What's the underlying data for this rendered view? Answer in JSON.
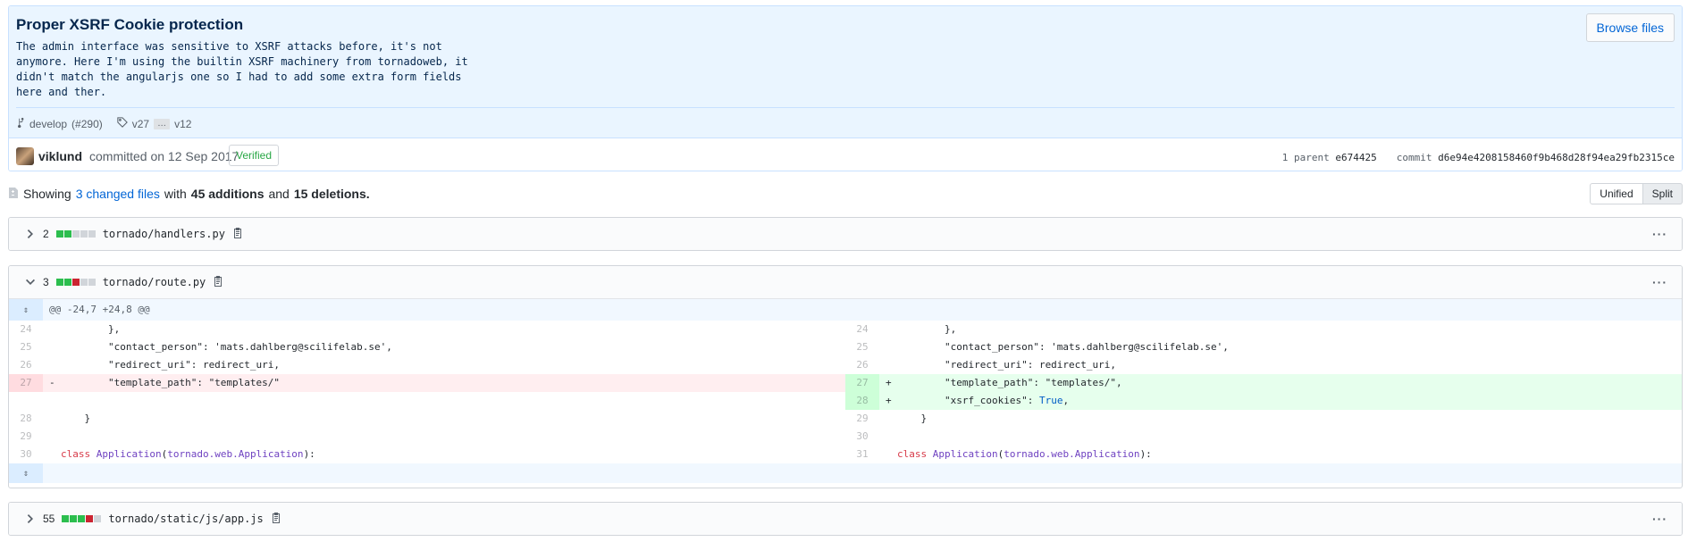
{
  "commit": {
    "title": "Proper XSRF Cookie protection",
    "description": "The admin interface was sensitive to XSRF attacks before, it's not\nanymore. Here I'm using the builtin XSRF machinery from tornadoweb, it\ndidn't match the angularjs one so I had to add some extra form fields\nhere and ther.",
    "browse_label": "Browse files",
    "branch": "develop",
    "pr": "(#290)",
    "tag_from": "v27",
    "tag_ellipsis": "…",
    "tag_to": "v12",
    "author": "viklund",
    "committed_text": "committed on 12 Sep 2017",
    "verified": "Verified",
    "parent_label": "1 parent",
    "parent_sha": "e674425",
    "commit_label": "commit",
    "commit_sha": "d6e94e4208158460f9b468d28f94ea29fb2315ce"
  },
  "toc": {
    "showing": "Showing",
    "changed_files": "3 changed files",
    "with": "with",
    "additions": "45 additions",
    "and": "and",
    "deletions": "15 deletions."
  },
  "view": {
    "unified": "Unified",
    "split": "Split"
  },
  "files": [
    {
      "count": "2",
      "name": "tornado/handlers.py",
      "stat": [
        "g",
        "g",
        "n",
        "n",
        "n"
      ]
    },
    {
      "count": "3",
      "name": "tornado/route.py",
      "stat": [
        "g",
        "g",
        "r",
        "n",
        "n"
      ]
    },
    {
      "count": "55",
      "name": "tornado/static/js/app.js",
      "stat": [
        "g",
        "g",
        "g",
        "r",
        "n"
      ]
    }
  ],
  "hunk": "@@ -24,7 +24,8 @@",
  "diff_rows": [
    {
      "left": {
        "ln": "24",
        "code": "        },",
        "type": "ctx"
      },
      "right": {
        "ln": "24",
        "code": "        },",
        "type": "ctx"
      }
    },
    {
      "left": {
        "ln": "25",
        "code": "        \"contact_person\": 'mats.dahlberg@scilifelab.se',",
        "type": "ctx"
      },
      "right": {
        "ln": "25",
        "code": "        \"contact_person\": 'mats.dahlberg@scilifelab.se',",
        "type": "ctx"
      }
    },
    {
      "left": {
        "ln": "26",
        "code": "        \"redirect_uri\": redirect_uri,",
        "type": "ctx"
      },
      "right": {
        "ln": "26",
        "code": "        \"redirect_uri\": redirect_uri,",
        "type": "ctx"
      }
    },
    {
      "left": {
        "ln": "27",
        "code": "        \"template_path\": \"templates/\"",
        "type": "del",
        "sign": "-"
      },
      "right": {
        "ln": "27",
        "code": "        \"template_path\": \"templates/\",",
        "type": "add",
        "sign": "+"
      }
    },
    {
      "left": {
        "ln": "",
        "code": "",
        "type": "empty"
      },
      "right": {
        "ln": "28",
        "code": "        \"xsrf_cookies\": ",
        "const": "True",
        "tail": ",",
        "type": "add",
        "sign": "+"
      }
    },
    {
      "left": {
        "ln": "28",
        "code": "    }",
        "type": "ctx"
      },
      "right": {
        "ln": "29",
        "code": "    }",
        "type": "ctx"
      }
    },
    {
      "left": {
        "ln": "29",
        "code": "",
        "type": "ctx"
      },
      "right": {
        "ln": "30",
        "code": "",
        "type": "ctx"
      }
    },
    {
      "left": {
        "ln": "30",
        "kw": "class",
        "cls": "Application",
        "args": "tornado.web.Application",
        "type": "class"
      },
      "right": {
        "ln": "31",
        "kw": "class",
        "cls": "Application",
        "args": "tornado.web.Application",
        "type": "class"
      }
    }
  ],
  "colors": {
    "accent": "#0366d6",
    "add": "#2cbe4e",
    "del": "#cb2431",
    "verified": "#28a745"
  },
  "icons": [
    "git-branch-icon",
    "tag-icon",
    "avatar",
    "file-diff-icon",
    "chevron-right-icon",
    "chevron-down-icon",
    "clipboard-icon",
    "kebab-icon",
    "expand-icon"
  ]
}
